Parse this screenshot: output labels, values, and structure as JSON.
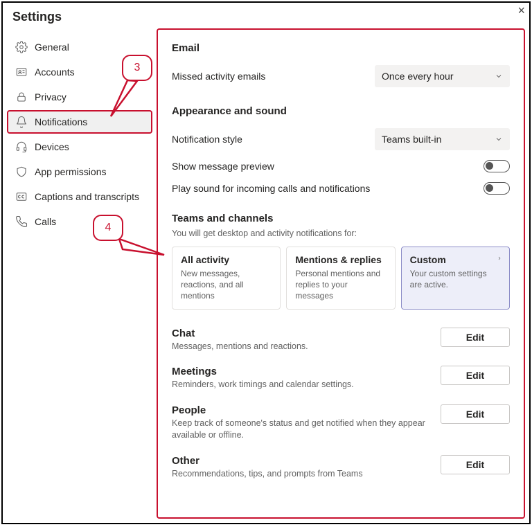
{
  "title": "Settings",
  "nav": [
    {
      "id": "general",
      "label": "General"
    },
    {
      "id": "accounts",
      "label": "Accounts"
    },
    {
      "id": "privacy",
      "label": "Privacy"
    },
    {
      "id": "notifications",
      "label": "Notifications"
    },
    {
      "id": "devices",
      "label": "Devices"
    },
    {
      "id": "app-permissions",
      "label": "App permissions"
    },
    {
      "id": "captions",
      "label": "Captions and transcripts"
    },
    {
      "id": "calls",
      "label": "Calls"
    }
  ],
  "sections": {
    "email": {
      "title": "Email",
      "missed_label": "Missed activity emails",
      "missed_value": "Once every hour"
    },
    "appearance": {
      "title": "Appearance and sound",
      "style_label": "Notification style",
      "style_value": "Teams built-in",
      "preview_label": "Show message preview",
      "sound_label": "Play sound for incoming calls and notifications"
    },
    "teams_channels": {
      "title": "Teams and channels",
      "sub": "You will get desktop and activity notifications for:",
      "cards": [
        {
          "title": "All activity",
          "desc": "New messages, reactions, and all mentions"
        },
        {
          "title": "Mentions & replies",
          "desc": "Personal mentions and replies to your messages"
        },
        {
          "title": "Custom",
          "desc": "Your custom settings are active."
        }
      ]
    },
    "chat": {
      "title": "Chat",
      "desc": "Messages, mentions and reactions.",
      "btn": "Edit"
    },
    "meetings": {
      "title": "Meetings",
      "desc": "Reminders, work timings and calendar settings.",
      "btn": "Edit"
    },
    "people": {
      "title": "People",
      "desc": "Keep track of someone's status and get notified when they appear available or offline.",
      "btn": "Edit"
    },
    "other": {
      "title": "Other",
      "desc": "Recommendations, tips, and prompts from Teams",
      "btn": "Edit"
    }
  },
  "callouts": {
    "c3": "3",
    "c4": "4"
  }
}
